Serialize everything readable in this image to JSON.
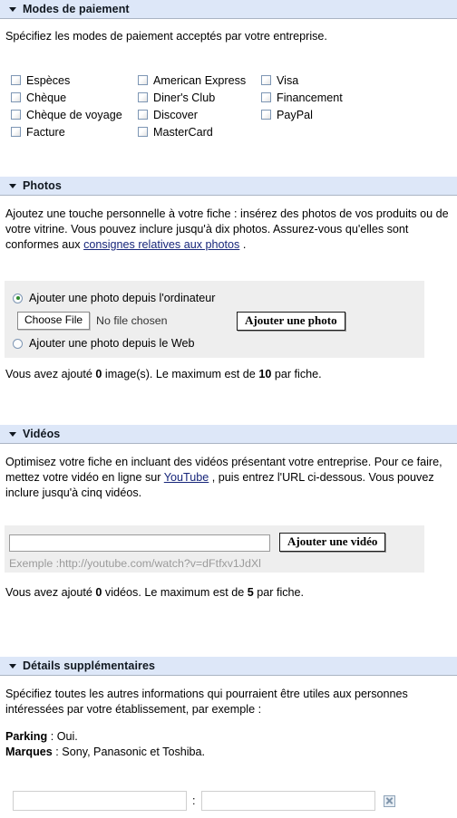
{
  "sections": {
    "payment": {
      "title": "Modes de paiement",
      "description": "Spécifiez les modes de paiement acceptés par votre entreprise.",
      "columns": [
        {
          "options": [
            "Espèces",
            "Chèque",
            "Chèque de voyage",
            "Facture"
          ]
        },
        {
          "options": [
            "American Express",
            "Diner's Club",
            "Discover",
            "MasterCard"
          ]
        },
        {
          "options": [
            "Visa",
            "Financement",
            "PayPal"
          ]
        }
      ]
    },
    "photos": {
      "title": "Photos",
      "description_part1": "Ajoutez une touche personnelle à votre fiche : insérez des photos de vos produits ou de votre vitrine. Vous pouvez inclure jusqu'à dix photos. Assurez-vous qu'elles sont conformes aux ",
      "link_label": "consignes relatives aux photos",
      "description_part2": " .",
      "radio_computer": "Ajouter une photo depuis l'ordinateur",
      "radio_web": "Ajouter une photo depuis le Web",
      "choose_file_label": "Choose File",
      "no_file_label": "No file chosen",
      "add_photo_button": "Ajouter une photo",
      "status_prefix": "Vous avez ajouté ",
      "status_count": "0",
      "status_middle": " image(s). Le maximum est de ",
      "status_max": "10",
      "status_suffix": " par fiche."
    },
    "videos": {
      "title": "Vidéos",
      "description_part1": "Optimisez votre fiche en incluant des vidéos présentant votre entreprise. Pour ce faire, mettez votre vidéo en ligne sur ",
      "link_label": "YouTube",
      "description_part2": " , puis entrez l'URL ci-dessous. Vous pouvez inclure jusqu'à cinq vidéos.",
      "url_value": "",
      "url_placeholder": "",
      "example_hint": "Exemple :http://youtube.com/watch?v=dFtfxv1JdXl",
      "add_video_button": "Ajouter une vidéo",
      "status_prefix": "Vous avez ajouté ",
      "status_count": "0",
      "status_middle": " vidéos. Le maximum est de ",
      "status_max": "5",
      "status_suffix": " par fiche."
    },
    "details": {
      "title": "Détails supplémentaires",
      "description": "Spécifiez toutes les autres informations qui pourraient être utiles aux personnes intéressées par votre établissement, par exemple :",
      "example_1_label": "Parking",
      "example_1_value": " : Oui.",
      "example_2_label": "Marques",
      "example_2_value": " : Sony, Panasonic et Toshiba.",
      "key_value": "",
      "key_placeholder": "",
      "value_value": "",
      "value_placeholder": "",
      "separator": ":"
    }
  },
  "colors": {
    "header_bg": "#dde7f8",
    "panel_bg": "#eeeeee",
    "link": "#17267a",
    "radio_dot": "#2c8a2c"
  },
  "icons": {
    "collapse": "triangle-down-icon",
    "delete_row": "delete-row-icon"
  }
}
